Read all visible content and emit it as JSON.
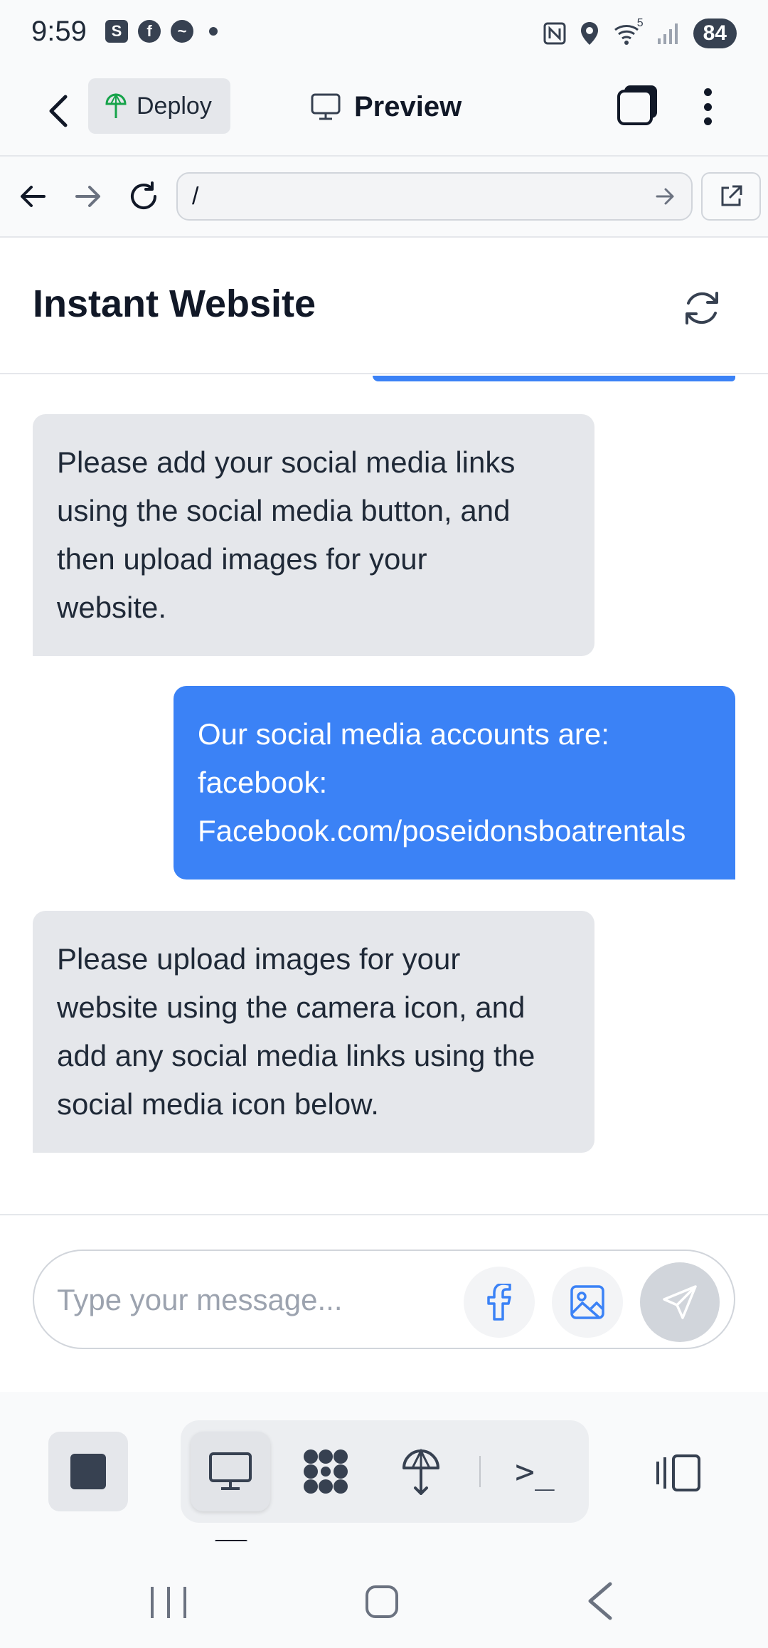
{
  "status_bar": {
    "time": "9:59",
    "left_icons": [
      "s-app-icon",
      "facebook-icon",
      "messenger-icon",
      "dot-icon"
    ],
    "right_icons": [
      "nfc-icon",
      "location-icon",
      "wifi-icon",
      "signal-icon"
    ],
    "wifi_label": "5",
    "battery": "84"
  },
  "header": {
    "deploy_label": "Deploy",
    "title": "Preview"
  },
  "url_bar": {
    "url": "/"
  },
  "site": {
    "title": "Instant Website"
  },
  "messages": [
    {
      "role": "bot",
      "lines": [
        "Please add your social media links",
        "using the social media button, and",
        "then upload images for your",
        "website."
      ]
    },
    {
      "role": "user",
      "lines": [
        "Our social media accounts are:",
        "facebook:",
        "Facebook.com/poseidonsboatrentals"
      ]
    },
    {
      "role": "bot",
      "lines": [
        "Please upload images for your",
        "website using the camera icon, and",
        "add any social media links using the",
        "social media icon below."
      ]
    }
  ],
  "composer": {
    "placeholder": "Type your message..."
  },
  "toolbar": {
    "terminal_symbol": ">_"
  },
  "colors": {
    "user_bubble": "#3b82f6",
    "bot_bubble": "#e5e7eb",
    "facebook_blue": "#3b82f6"
  }
}
